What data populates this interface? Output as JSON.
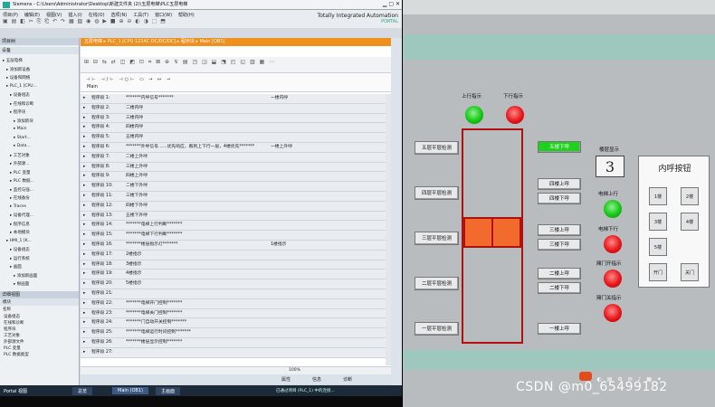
{
  "tia": {
    "window_title": "Siemens - C:\\Users\\Administrator\\Desktop\\新建文件夹 (2)\\五层电梯\\PLC五层电梯",
    "menu": [
      "项目(P)",
      "编辑(E)",
      "视图(V)",
      "插入(I)",
      "在线(O)",
      "选项(N)",
      "工具(T)",
      "窗口(W)",
      "帮助(H)"
    ],
    "brand": "Totally Integrated Automation",
    "brand_sub": "PORTAL",
    "left_pane_title": "项目树",
    "device_tab": "设备",
    "tree": [
      "五层电梯",
      "添加新设备",
      "设备和网络",
      "PLC_1 [CPU...",
      "设备组态",
      "在线和诊断",
      "程序块",
      "添加新块",
      "Main",
      "Start...",
      "Data...",
      "工艺对象",
      "外部源...",
      "PLC 变量",
      "PLC 数据...",
      "监控与强...",
      "在线备份",
      "Traces",
      "设备代理...",
      "程序信息",
      "本地模块",
      "HMI_1 [K...",
      "设备组态",
      "运行系统",
      "画面",
      "添加新画面",
      "根画面"
    ],
    "details_title": "详细视图",
    "details_tab": "模块",
    "details_col": "名称",
    "details_items": [
      "设备组态",
      "在线和诊断",
      "程序块",
      "工艺对象",
      "外部源文件",
      "PLC 变量",
      "PLC 数据类型"
    ],
    "breadcrumb": "五层电梯 ▸ PLC_1 [CPU 1214C DC/DC/DC] ▸ 程序块 ▸ Main [OB1]",
    "block_label": "Main",
    "segment_word": "程序段",
    "networks": [
      {
        "n": "1:",
        "c": "*******内呼信号*******",
        "c2": "一楼内呼"
      },
      {
        "n": "2:",
        "c": "二楼内呼",
        "c2": ""
      },
      {
        "n": "3:",
        "c": "三楼内呼",
        "c2": ""
      },
      {
        "n": "4:",
        "c": "四楼内呼",
        "c2": ""
      },
      {
        "n": "5:",
        "c": "五楼内呼",
        "c2": ""
      },
      {
        "n": "6:",
        "c": "*******外呼信号……优先响应，再到上下行一层，4楼优先*******",
        "c2": "一楼上外呼"
      },
      {
        "n": "7:",
        "c": "二楼上外呼",
        "c2": ""
      },
      {
        "n": "8:",
        "c": "三楼上外呼",
        "c2": ""
      },
      {
        "n": "9:",
        "c": "四楼上外呼",
        "c2": ""
      },
      {
        "n": "10:",
        "c": "二楼下外呼",
        "c2": ""
      },
      {
        "n": "11:",
        "c": "三楼下外呼",
        "c2": ""
      },
      {
        "n": "12:",
        "c": "四楼下外呼",
        "c2": ""
      },
      {
        "n": "13:",
        "c": "五楼下外呼",
        "c2": ""
      },
      {
        "n": "14:",
        "c": "*******电梯上行判断*******",
        "c2": ""
      },
      {
        "n": "15:",
        "c": "*******电梯下行判断*******",
        "c2": ""
      },
      {
        "n": "16:",
        "c": "*******楼层指示灯*******",
        "c2": "1楼指示"
      },
      {
        "n": "17:",
        "c": "2楼指示",
        "c2": ""
      },
      {
        "n": "18:",
        "c": "3楼指示",
        "c2": ""
      },
      {
        "n": "19:",
        "c": "4楼指示",
        "c2": ""
      },
      {
        "n": "20:",
        "c": "5楼指示",
        "c2": ""
      },
      {
        "n": "21:",
        "c": "",
        "c2": ""
      },
      {
        "n": "22:",
        "c": "*******电梯开门控制*******",
        "c2": ""
      },
      {
        "n": "23:",
        "c": "*******电梯关门控制*******",
        "c2": ""
      },
      {
        "n": "24:",
        "c": "*******门自动开关控制*******",
        "c2": ""
      },
      {
        "n": "25:",
        "c": "*******电梯运行时间控制*******",
        "c2": ""
      },
      {
        "n": "26:",
        "c": "*******楼层显示控制*******",
        "c2": ""
      },
      {
        "n": "27:",
        "c": "",
        "c2": ""
      }
    ],
    "zoom": "100%",
    "bottom_tabs": [
      "属性",
      "信息",
      "诊断"
    ],
    "taskbar": [
      "Portal 视图",
      "总览",
      "Main (OB1)",
      "主画面"
    ],
    "status": "已通过项目 (PLC_1) 中的连接..."
  },
  "hmi": {
    "up_label": "上行指示",
    "down_label": "下行指示",
    "floor_display_label": "楼层显示",
    "floor_value": "3",
    "floor_sensors": [
      "五层平层检测",
      "四层平层检测",
      "三层平层检测",
      "二层平层检测",
      "一层平层检测"
    ],
    "outside_buttons": [
      "五楼下呼",
      "四楼上呼",
      "四楼下呼",
      "三楼上呼",
      "三楼下呼",
      "二楼上呼",
      "二楼下呼",
      "一楼上呼"
    ],
    "status_labels": [
      "电梯上行",
      "电梯下行",
      "厢门开指示",
      "厢门关指示"
    ],
    "inner_title": "内呼按钮",
    "inner_buttons": [
      "1楼",
      "2楼",
      "3楼",
      "4楼",
      "5楼",
      "开门",
      "关门"
    ],
    "colors": {
      "green": "#1cd21c",
      "red": "#e8161a",
      "car": "#f26a2c",
      "shaft": "#b01010",
      "band": "#9ec8be"
    }
  },
  "watermark": "CSDN @m0_65499182"
}
